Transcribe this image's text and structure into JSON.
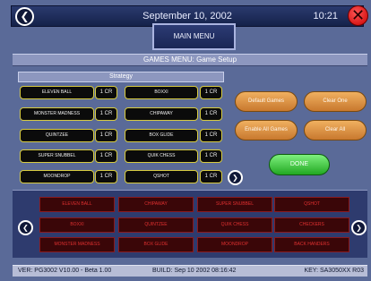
{
  "header": {
    "date": "September 10, 2002",
    "time": "10:21"
  },
  "main_menu_label": "MAIN MENU",
  "section_title": "GAMES MENU: Game Setup",
  "strategy": {
    "header": "Strategy",
    "left_games": [
      {
        "name": "ELEVEN BALL",
        "credit": "1 CR"
      },
      {
        "name": "MONSTER MADNESS",
        "credit": "1 CR"
      },
      {
        "name": "QUINTZEE",
        "credit": "1 CR"
      },
      {
        "name": "SUPER SNUBBEL",
        "credit": "1 CR"
      },
      {
        "name": "MOONDROP",
        "credit": "1 CR"
      }
    ],
    "right_games": [
      {
        "name": "BOXXI",
        "credit": "1 CR"
      },
      {
        "name": "CHIPAWAY",
        "credit": "1 CR"
      },
      {
        "name": "BOX GLIDE",
        "credit": "1 CR"
      },
      {
        "name": "QUIK CHESS",
        "credit": "1 CR"
      },
      {
        "name": "QSHOT",
        "credit": "1 CR"
      }
    ]
  },
  "actions": {
    "default_games": "Default Games",
    "clear_one": "Clear One",
    "enable_all_games": "Enable All Games",
    "clear_all": "Clear All",
    "done": "DONE"
  },
  "selected_games": [
    "ELEVEN BALL",
    "CHIPAWAY",
    "SUPER SNUBBEL",
    "QSHOT",
    "BOXXI",
    "QUINTZEE",
    "QUIK CHESS",
    "CHECKERS",
    "MONSTER MADNESS",
    "BOX GLIDE",
    "MOONDROP",
    "BACK HANDERS"
  ],
  "status": {
    "version": "VER:  PG3002 V10.00 - Beta 1.00",
    "build": "BUILD:  Sep 10 2002  08:16:42",
    "key": "KEY:  SA3050XX R03"
  },
  "colors": {
    "background": "#5a6a98",
    "game_button_border": "#d8cc40",
    "action_orange": "#e09a48",
    "done_green": "#3cc83c",
    "selected_red": "#e03030",
    "close_red": "#e01818"
  },
  "icons": {
    "back": "chevron-left-icon",
    "close": "close-icon",
    "more": "chevron-right-icon",
    "tray_left": "chevron-left-icon",
    "tray_right": "chevron-right-icon"
  }
}
